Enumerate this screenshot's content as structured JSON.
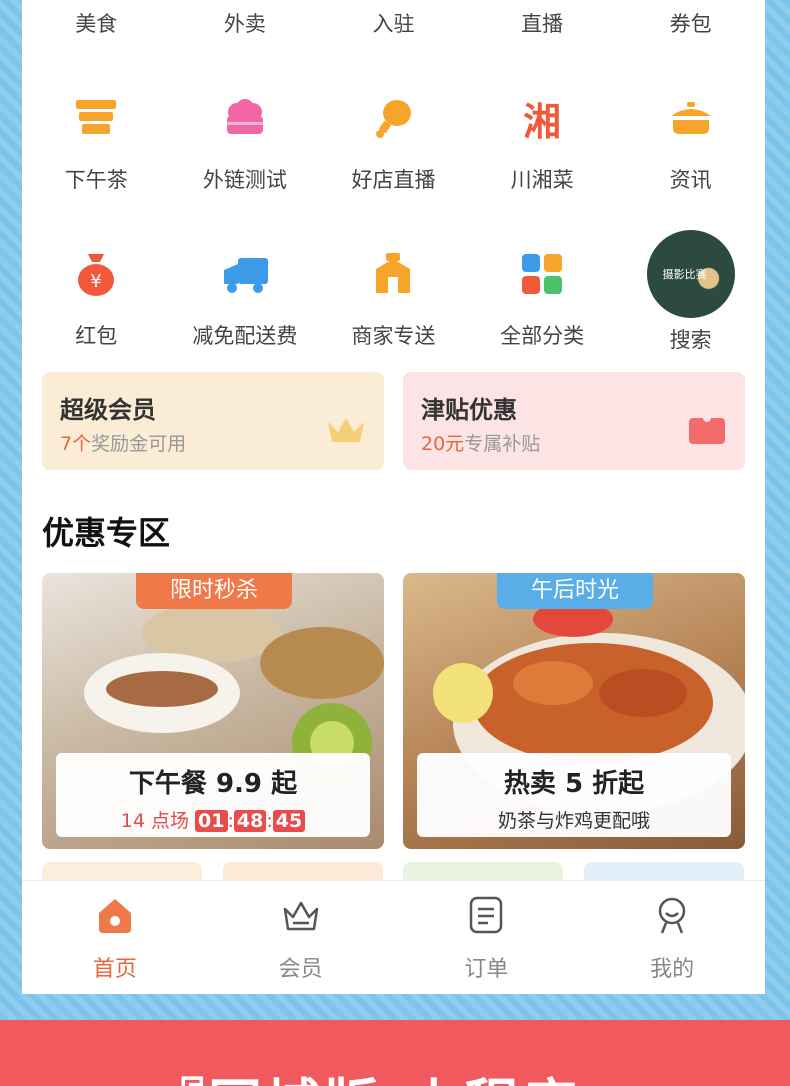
{
  "top_labels": [
    "美食",
    "外卖",
    "入驻",
    "直播",
    "券包"
  ],
  "grid_row1": [
    {
      "label": "下午茶",
      "icon": "cup-icon"
    },
    {
      "label": "外链测试",
      "icon": "cake-icon"
    },
    {
      "label": "好店直播",
      "icon": "drumstick-icon"
    },
    {
      "label": "川湘菜",
      "icon": "xiang-char-icon",
      "glyph": "湘"
    },
    {
      "label": "资讯",
      "icon": "pot-icon"
    }
  ],
  "grid_row2": [
    {
      "label": "红包",
      "icon": "money-bag-icon",
      "glyph": "¥"
    },
    {
      "label": "减免配送费",
      "icon": "truck-icon"
    },
    {
      "label": "商家专送",
      "icon": "scooter-icon"
    },
    {
      "label": "全部分类",
      "icon": "grid-icon"
    },
    {
      "label": "搜索",
      "icon": "photo-contest-icon",
      "photo_text": "摄影比赛"
    }
  ],
  "cards": {
    "member": {
      "title": "超级会员",
      "count": "7个",
      "suffix": "奖励金可用",
      "bg": "#fbedd5"
    },
    "subsidy": {
      "title": "津贴优惠",
      "count": "20元",
      "suffix": "专属补贴",
      "bg": "#fce4e4"
    }
  },
  "section_title": "优惠专区",
  "promo1": {
    "tag": "限时秒杀",
    "title": "下午餐 9.9 起",
    "session": "14 点场",
    "hh": "01",
    "mm": "48",
    "ss": "45",
    "tag_color": "#f0794a"
  },
  "promo2": {
    "tag": "午后时光",
    "title": "热卖 5 折起",
    "subtitle": "奶茶与炸鸡更配哦",
    "tag_color": "#5aaee8"
  },
  "tabs": [
    {
      "label": "首页",
      "icon": "home-icon",
      "active": true
    },
    {
      "label": "会员",
      "icon": "crown-icon",
      "active": false
    },
    {
      "label": "订单",
      "icon": "order-icon",
      "active": false
    },
    {
      "label": "我的",
      "icon": "profile-icon",
      "active": false
    }
  ],
  "banner": {
    "text": "『同城版·小程序』"
  },
  "colors": {
    "accent": "#e8663d",
    "orange": "#f7a52a",
    "red": "#f05a5e",
    "blue": "#3b9be8"
  }
}
